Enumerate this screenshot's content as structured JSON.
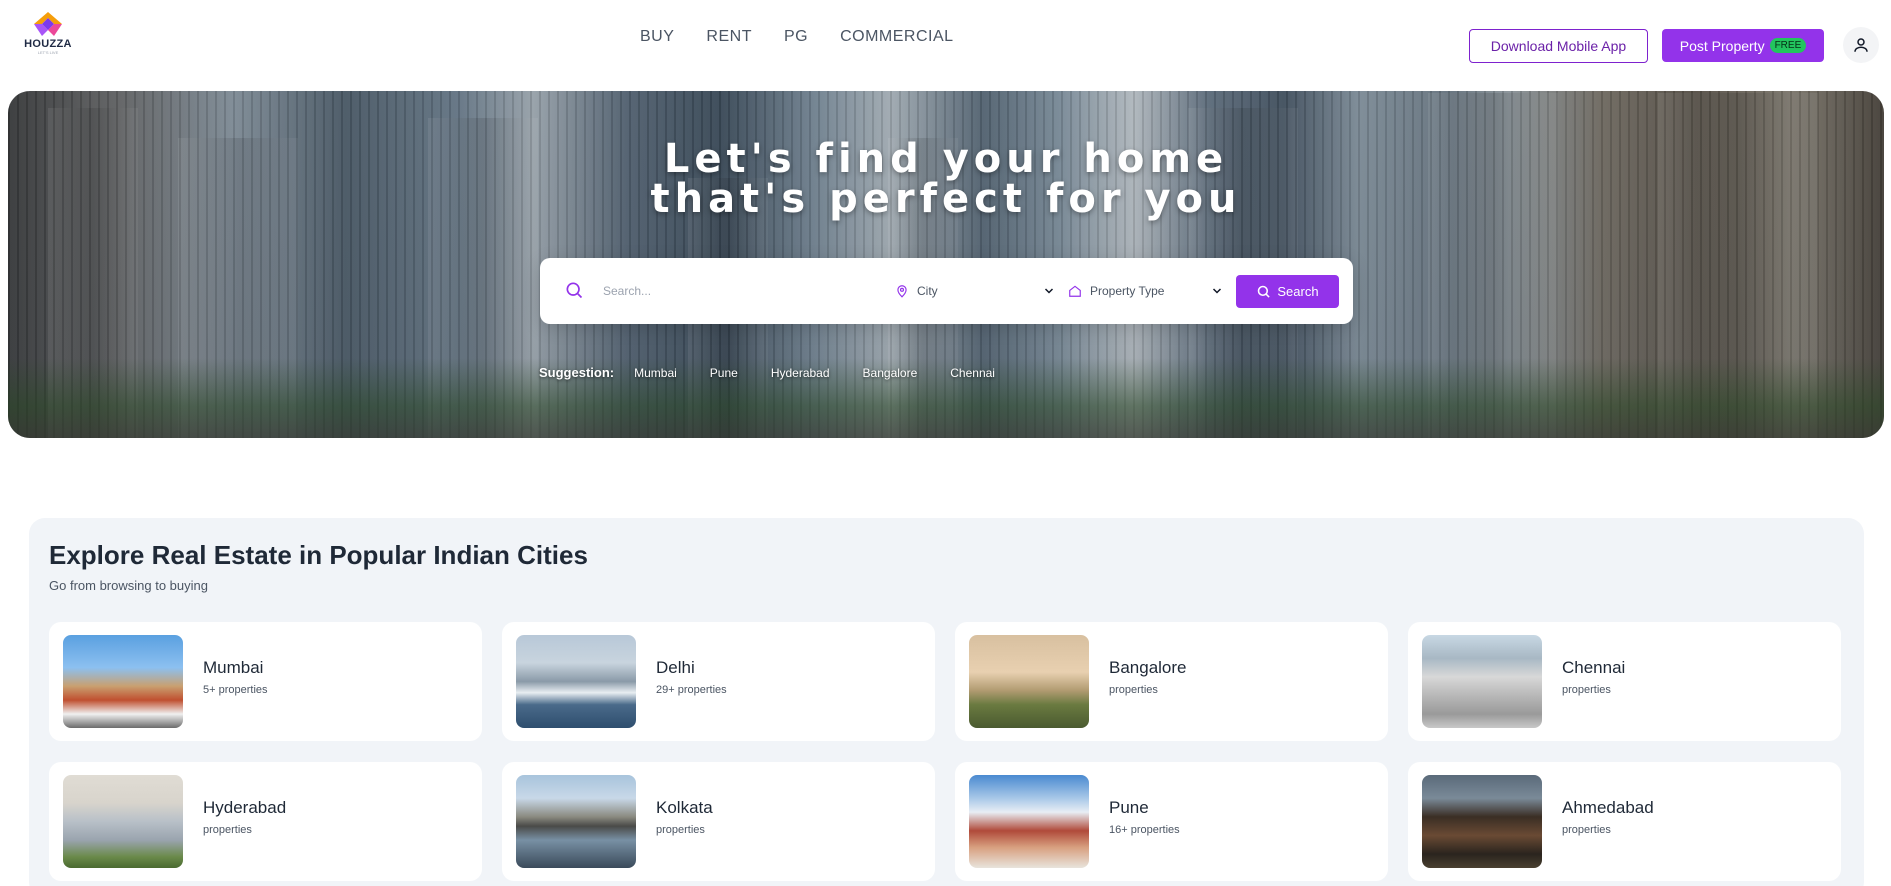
{
  "header": {
    "logo_text": "HOUZZA",
    "logo_tagline": "LET'S LIVE",
    "nav": [
      "BUY",
      "RENT",
      "PG",
      "COMMERCIAL"
    ],
    "download_label": "Download Mobile App",
    "post_label": "Post Property",
    "free_badge": "FREE"
  },
  "hero": {
    "title_line1": "Let's find your home",
    "title_line2": "that's perfect for you",
    "search_placeholder": "Search...",
    "city_label": "City",
    "property_type_label": "Property Type",
    "search_button": "Search",
    "suggestion_label": "Suggestion:",
    "suggestions": [
      "Mumbai",
      "Pune",
      "Hyderabad",
      "Bangalore",
      "Chennai"
    ]
  },
  "explore": {
    "title": "Explore Real Estate in Popular Indian Cities",
    "subtitle": "Go from browsing to buying",
    "cities": [
      {
        "name": "Mumbai",
        "count": "5+ properties"
      },
      {
        "name": "Delhi",
        "count": "29+ properties"
      },
      {
        "name": "Bangalore",
        "count": "properties"
      },
      {
        "name": "Chennai",
        "count": "properties"
      },
      {
        "name": "Hyderabad",
        "count": "properties"
      },
      {
        "name": "Kolkata",
        "count": "properties"
      },
      {
        "name": "Pune",
        "count": "16+ properties"
      },
      {
        "name": "Ahmedabad",
        "count": "properties"
      }
    ]
  },
  "colors": {
    "primary": "#9333ea",
    "free_badge": "#22c55e",
    "section_bg": "#f1f4f8"
  }
}
